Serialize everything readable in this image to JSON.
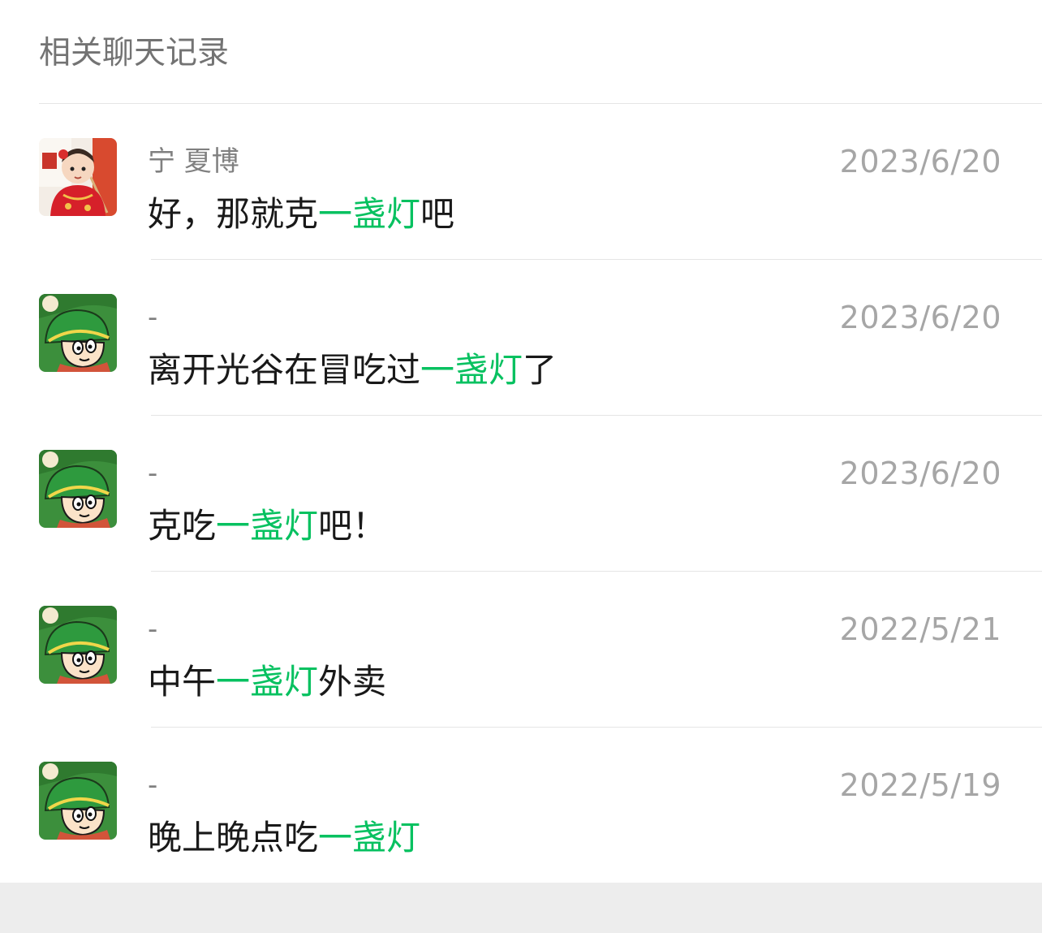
{
  "section_title": "相关聊天记录",
  "colors": {
    "highlight": "#07c160",
    "name_text": "#808080",
    "date_text": "#a6a6a6",
    "message_text": "#191919",
    "page_background": "#ededed"
  },
  "results": [
    {
      "avatar": "baby-photo-avatar",
      "name": "宁  夏博",
      "date": "2023/6/20",
      "message": {
        "before": "好，那就克",
        "match": "一盏灯",
        "after": "吧"
      }
    },
    {
      "avatar": "cartoon-boy-avatar",
      "name": "-",
      "date": "2023/6/20",
      "message": {
        "before": "离开光谷在冒吃过",
        "match": "一盏灯",
        "after": "了"
      }
    },
    {
      "avatar": "cartoon-boy-avatar",
      "name": "-",
      "date": "2023/6/20",
      "message": {
        "before": "克吃",
        "match": "一盏灯",
        "after": "吧！"
      }
    },
    {
      "avatar": "cartoon-boy-avatar",
      "name": "-",
      "date": "2022/5/21",
      "message": {
        "before": "中午",
        "match": "一盏灯",
        "after": "外卖"
      }
    },
    {
      "avatar": "cartoon-boy-avatar",
      "name": "-",
      "date": "2022/5/19",
      "message": {
        "before": "晚上晚点吃",
        "match": "一盏灯",
        "after": ""
      }
    }
  ]
}
